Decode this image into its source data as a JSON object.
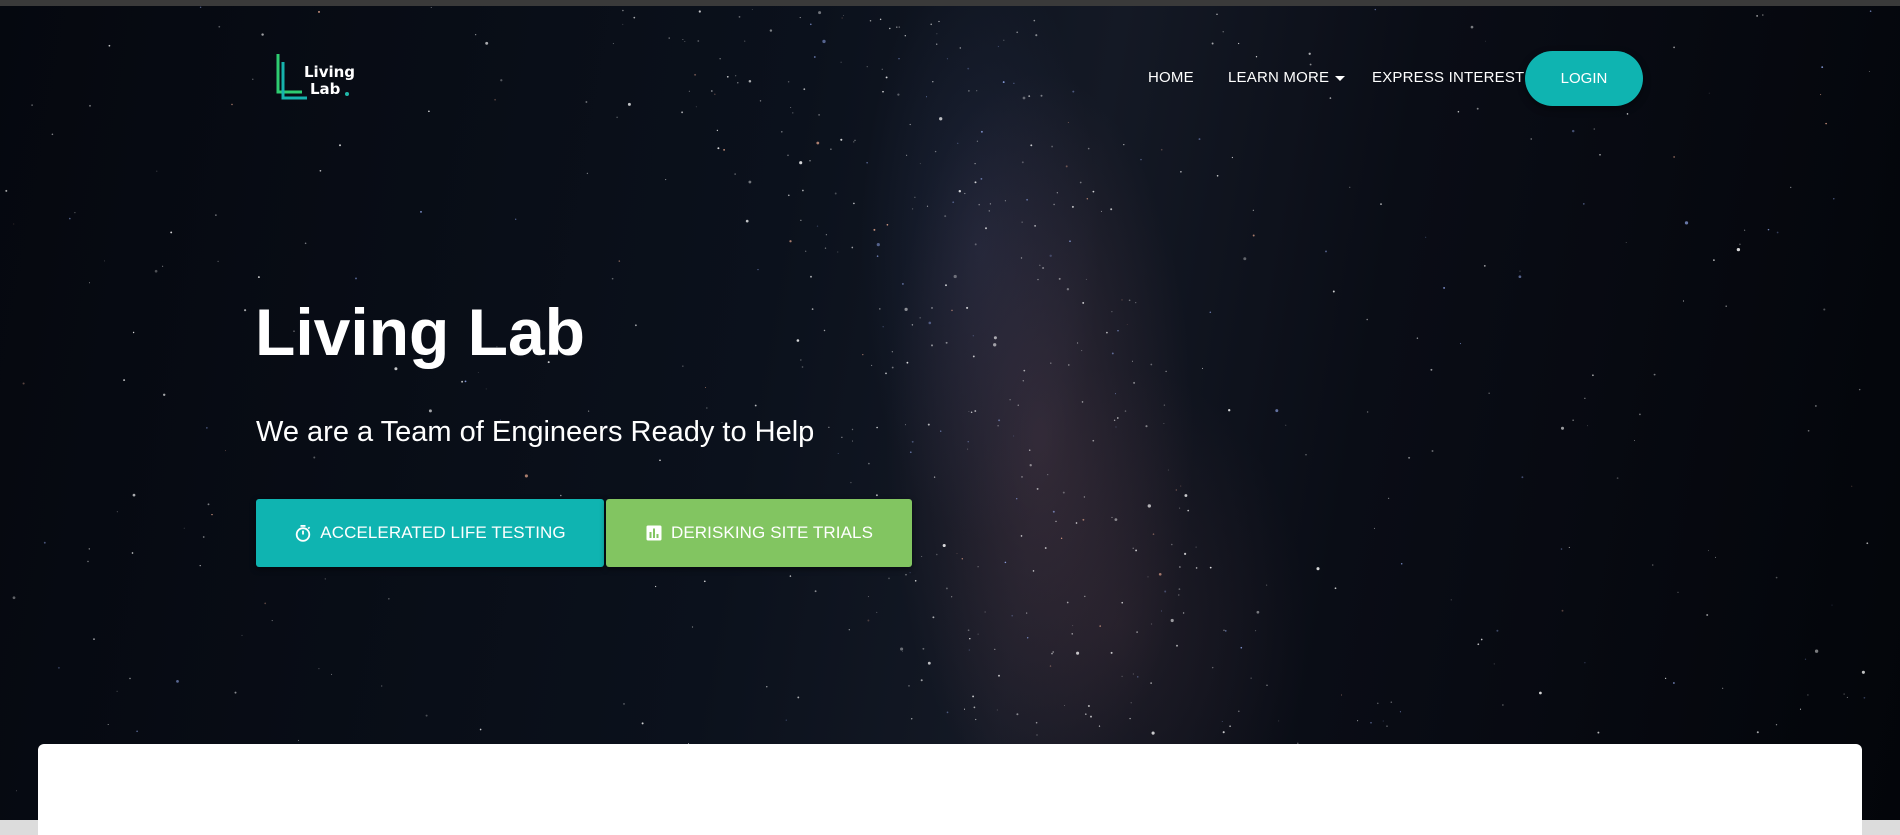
{
  "brand": {
    "logo_line1": "Living",
    "logo_line2": "Lab",
    "accent": "#0fb4b1",
    "secondary": "#82c561"
  },
  "nav": {
    "items": [
      {
        "label": "HOME"
      },
      {
        "label": "LEARN MORE",
        "has_dropdown": true
      },
      {
        "label": "EXPRESS INTEREST"
      }
    ],
    "login_label": "LOGIN"
  },
  "hero": {
    "title": "Living Lab",
    "subtitle": "We are a Team of Engineers Ready to Help",
    "buttons": [
      {
        "label": "ACCELERATED LIFE TESTING",
        "icon": "stopwatch-icon",
        "color": "#0fb4b1"
      },
      {
        "label": "DERISKING SITE TRIALS",
        "icon": "bar-chart-icon",
        "color": "#82c561"
      }
    ]
  }
}
